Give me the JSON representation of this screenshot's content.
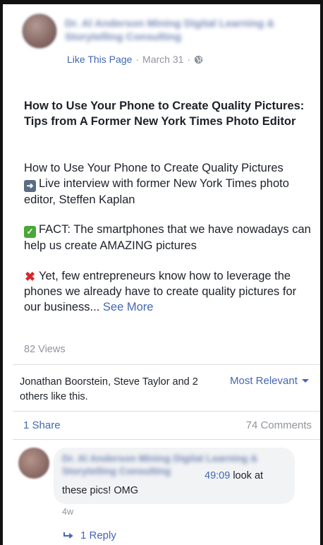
{
  "header": {
    "page_name_obscured": "Dr. Al Anderson Mining Digital Learning & Storytelling Consulting",
    "like_page_label": "Like This Page",
    "separator": "·",
    "date": "March 31",
    "separator2": "·",
    "privacy_icon": "globe-icon"
  },
  "post": {
    "title": "How to Use Your Phone to Create Quality Pictures: Tips from A Former New York Times Photo Editor",
    "paragraph1": "How to Use Your Phone to Create Quality Pictures",
    "paragraph1_line2": "Live interview with former New York Times photo editor, Steffen Kaplan",
    "paragraph2": "FACT: The smartphones that we have nowadays can help us create AMAZING pictures",
    "paragraph3": "Yet, few entrepreneurs know how to leverage the phones we already have to create quality pictures for our business...",
    "see_more": "See More",
    "emoji_arrow": "arrow-right-emoji",
    "emoji_check": "check-mark-emoji",
    "emoji_cross": "cross-mark-emoji"
  },
  "stats": {
    "views": "82 Views",
    "likers": "Jonathan Boorstein, Steve Taylor and 2 others like this.",
    "sort_label": "Most Relevant",
    "shares": "1 Share",
    "comments": "74 Comments"
  },
  "comment": {
    "author_obscured": "Dr. Al Anderson Mining Digital Learning & Storytelling Consulting",
    "timestamp": "49:09",
    "text": "look at these pics! OMG",
    "age": "4w",
    "replies": "1 Reply"
  },
  "colors": {
    "link": "#4267b2",
    "meta": "#90949c",
    "text": "#1d2129"
  }
}
